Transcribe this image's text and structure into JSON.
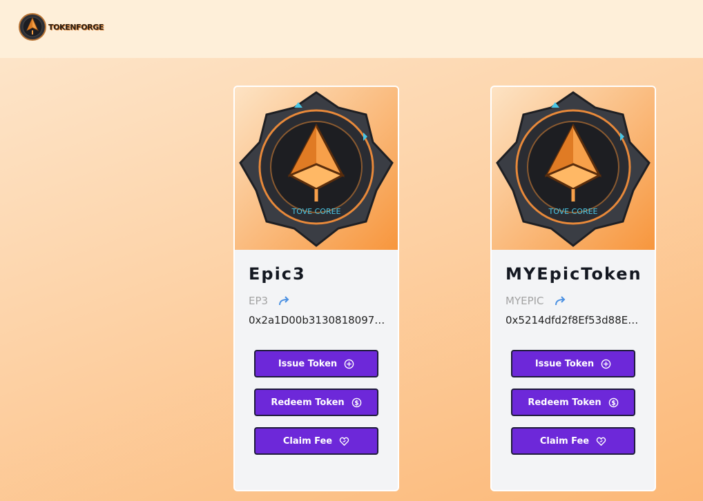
{
  "app": {
    "logo_text": "TOKENFORGE"
  },
  "cards": [
    {
      "name": "Epic3",
      "symbol": "EP3",
      "address": "0x2a1D00b31308180970…",
      "emblem_text": "TOVE COREE",
      "actions": {
        "issue": "Issue Token",
        "redeem": "Redeem Token",
        "claim": "Claim Fee"
      }
    },
    {
      "name": "MYEpicToken",
      "symbol": "MYEPIC",
      "address": "0x5214dfd2f8Ef53d88E4…",
      "emblem_text": "TOVE COREE",
      "actions": {
        "issue": "Issue Token",
        "redeem": "Redeem Token",
        "claim": "Claim Fee"
      }
    }
  ],
  "colors": {
    "accent": "#6d28d9",
    "header_bg": "#feefd9",
    "card_bg": "#f3f4f6",
    "share_icon": "#4a90e2"
  },
  "icons": [
    "logo-badge-icon",
    "share-arrow-icon",
    "plus-circle-icon",
    "dollar-circle-icon",
    "heart-hand-icon"
  ]
}
